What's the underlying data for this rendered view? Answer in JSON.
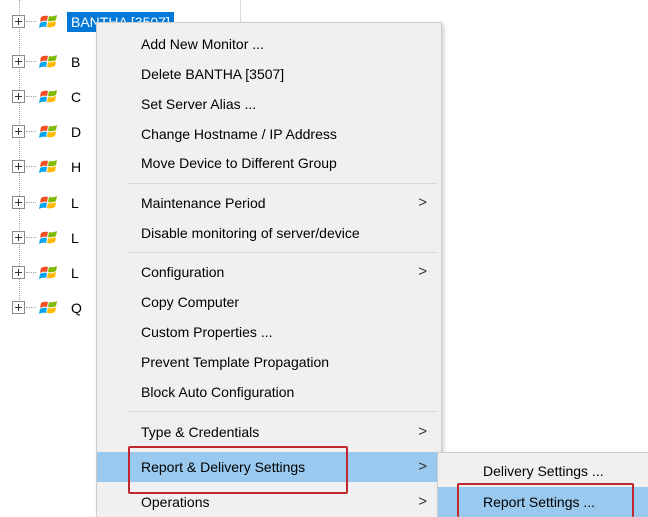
{
  "tree": {
    "nodes": [
      {
        "label": "BANTHA [3507]",
        "selected": true
      },
      {
        "label": "B"
      },
      {
        "label": "C"
      },
      {
        "label": "D"
      },
      {
        "label": "H"
      },
      {
        "label": "L"
      },
      {
        "label": "L"
      },
      {
        "label": "L"
      },
      {
        "label": "Q"
      }
    ],
    "icon": "windows-logo-icon"
  },
  "context_menu": {
    "items": [
      {
        "label": "Add New Monitor ..."
      },
      {
        "label": "Delete BANTHA [3507]"
      },
      {
        "label": "Set Server Alias ..."
      },
      {
        "label": "Change Hostname / IP Address"
      },
      {
        "label": "Move Device to Different Group"
      },
      {
        "label": "Maintenance Period",
        "submenu_arrow": ">"
      },
      {
        "label": "Disable monitoring of server/device"
      },
      {
        "label": "Configuration",
        "submenu_arrow": ">"
      },
      {
        "label": "Copy Computer"
      },
      {
        "label": "Custom Properties ..."
      },
      {
        "label": "Prevent Template Propagation"
      },
      {
        "label": "Block Auto Configuration"
      },
      {
        "label": "Type & Credentials",
        "submenu_arrow": ">"
      },
      {
        "label": "Report & Delivery Settings",
        "submenu_arrow": ">",
        "highlighted": true
      },
      {
        "label": "Operations",
        "submenu_arrow": ">"
      }
    ]
  },
  "submenu": {
    "items": [
      {
        "label": "Delivery Settings ..."
      },
      {
        "label": "Report Settings ...",
        "highlighted": true
      }
    ]
  },
  "colors": {
    "selection": "#0078d7",
    "menu_highlight": "#99c9ef",
    "menu_background": "#f0f0f0",
    "annotation_red": "#c0282d"
  }
}
